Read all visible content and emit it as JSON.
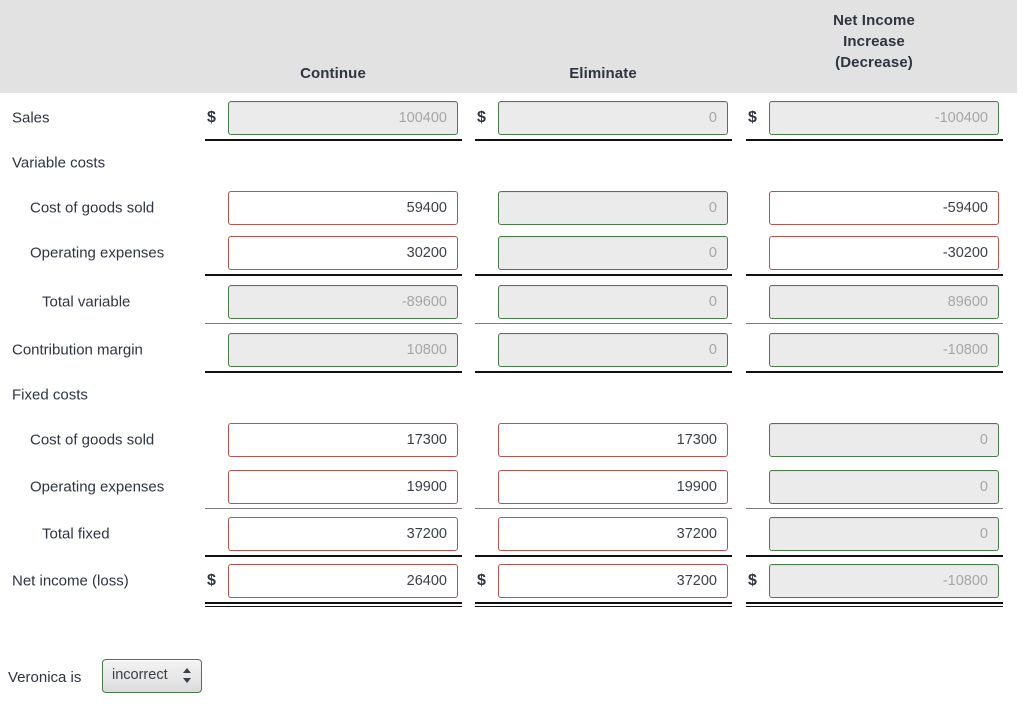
{
  "header": {
    "label_col": "",
    "columns": [
      {
        "label": "Continue"
      },
      {
        "label": "Eliminate"
      },
      {
        "label": "Net Income\nIncrease\n(Decrease)",
        "line1": "Net Income",
        "line2": "Increase",
        "line3": "(Decrease)"
      }
    ]
  },
  "colors": {
    "header_band": "#e2e2e2",
    "locked_border": "#4a7c4a",
    "locked_fill": "#ebebeb",
    "locked_text": "#a6a6a6",
    "editable_border": "#b4554d",
    "editable_text": "#3b4048",
    "rule": "#111111",
    "text": "#2e3440"
  },
  "rows": [
    {
      "label": "Sales",
      "indent": 0,
      "rule": "thick",
      "cells": [
        {
          "dollar": "$",
          "value": "100400",
          "state": "locked"
        },
        {
          "dollar": "$",
          "value": "0",
          "state": "locked"
        },
        {
          "dollar": "$",
          "value": "-100400",
          "state": "locked"
        }
      ]
    },
    {
      "label": "Variable costs",
      "indent": 0,
      "rule": "none",
      "cells": [
        {
          "dollar": "",
          "value": null,
          "state": "none"
        },
        {
          "dollar": "",
          "value": null,
          "state": "none"
        },
        {
          "dollar": "",
          "value": null,
          "state": "none"
        }
      ]
    },
    {
      "label": "Cost of goods sold",
      "indent": 1,
      "rule": "none",
      "cells": [
        {
          "dollar": "",
          "value": "59400",
          "state": "editable"
        },
        {
          "dollar": "",
          "value": "0",
          "state": "locked"
        },
        {
          "dollar": "",
          "value": "-59400",
          "state": "editable"
        }
      ]
    },
    {
      "label": "Operating expenses",
      "indent": 1,
      "rule": "thick",
      "cells": [
        {
          "dollar": "",
          "value": "30200",
          "state": "editable"
        },
        {
          "dollar": "",
          "value": "0",
          "state": "locked"
        },
        {
          "dollar": "",
          "value": "-30200",
          "state": "editable"
        }
      ]
    },
    {
      "label": "Total variable",
      "indent": 2,
      "rule": "thin",
      "cells": [
        {
          "dollar": "",
          "value": "-89600",
          "state": "locked"
        },
        {
          "dollar": "",
          "value": "0",
          "state": "locked"
        },
        {
          "dollar": "",
          "value": "89600",
          "state": "locked"
        }
      ]
    },
    {
      "label": "Contribution margin",
      "indent": 0,
      "rule": "thick",
      "cells": [
        {
          "dollar": "",
          "value": "10800",
          "state": "locked"
        },
        {
          "dollar": "",
          "value": "0",
          "state": "locked"
        },
        {
          "dollar": "",
          "value": "-10800",
          "state": "locked"
        }
      ]
    },
    {
      "label": "Fixed costs",
      "indent": 0,
      "rule": "none",
      "cells": [
        {
          "dollar": "",
          "value": null,
          "state": "none"
        },
        {
          "dollar": "",
          "value": null,
          "state": "none"
        },
        {
          "dollar": "",
          "value": null,
          "state": "none"
        }
      ]
    },
    {
      "label": "Cost of goods sold",
      "indent": 1,
      "rule": "none",
      "cells": [
        {
          "dollar": "",
          "value": "17300",
          "state": "editable"
        },
        {
          "dollar": "",
          "value": "17300",
          "state": "editable"
        },
        {
          "dollar": "",
          "value": "0",
          "state": "locked"
        }
      ]
    },
    {
      "label": "Operating expenses",
      "indent": 1,
      "rule": "thin",
      "cells": [
        {
          "dollar": "",
          "value": "19900",
          "state": "editable"
        },
        {
          "dollar": "",
          "value": "19900",
          "state": "editable"
        },
        {
          "dollar": "",
          "value": "0",
          "state": "locked"
        }
      ]
    },
    {
      "label": "Total fixed",
      "indent": 2,
      "rule": "thick",
      "cells": [
        {
          "dollar": "",
          "value": "37200",
          "state": "editable"
        },
        {
          "dollar": "",
          "value": "37200",
          "state": "editable"
        },
        {
          "dollar": "",
          "value": "0",
          "state": "locked"
        }
      ]
    },
    {
      "label": "Net income (loss)",
      "indent": 0,
      "rule": "double",
      "cells": [
        {
          "dollar": "$",
          "value": "26400",
          "state": "editable"
        },
        {
          "dollar": "$",
          "value": "37200",
          "state": "editable"
        },
        {
          "dollar": "$",
          "value": "-10800",
          "state": "locked"
        }
      ]
    }
  ],
  "footer": {
    "label": "Veronica is",
    "select": {
      "value": "incorrect",
      "options": [
        "correct",
        "incorrect"
      ],
      "arrows_icon": "updown-arrows-icon"
    }
  }
}
